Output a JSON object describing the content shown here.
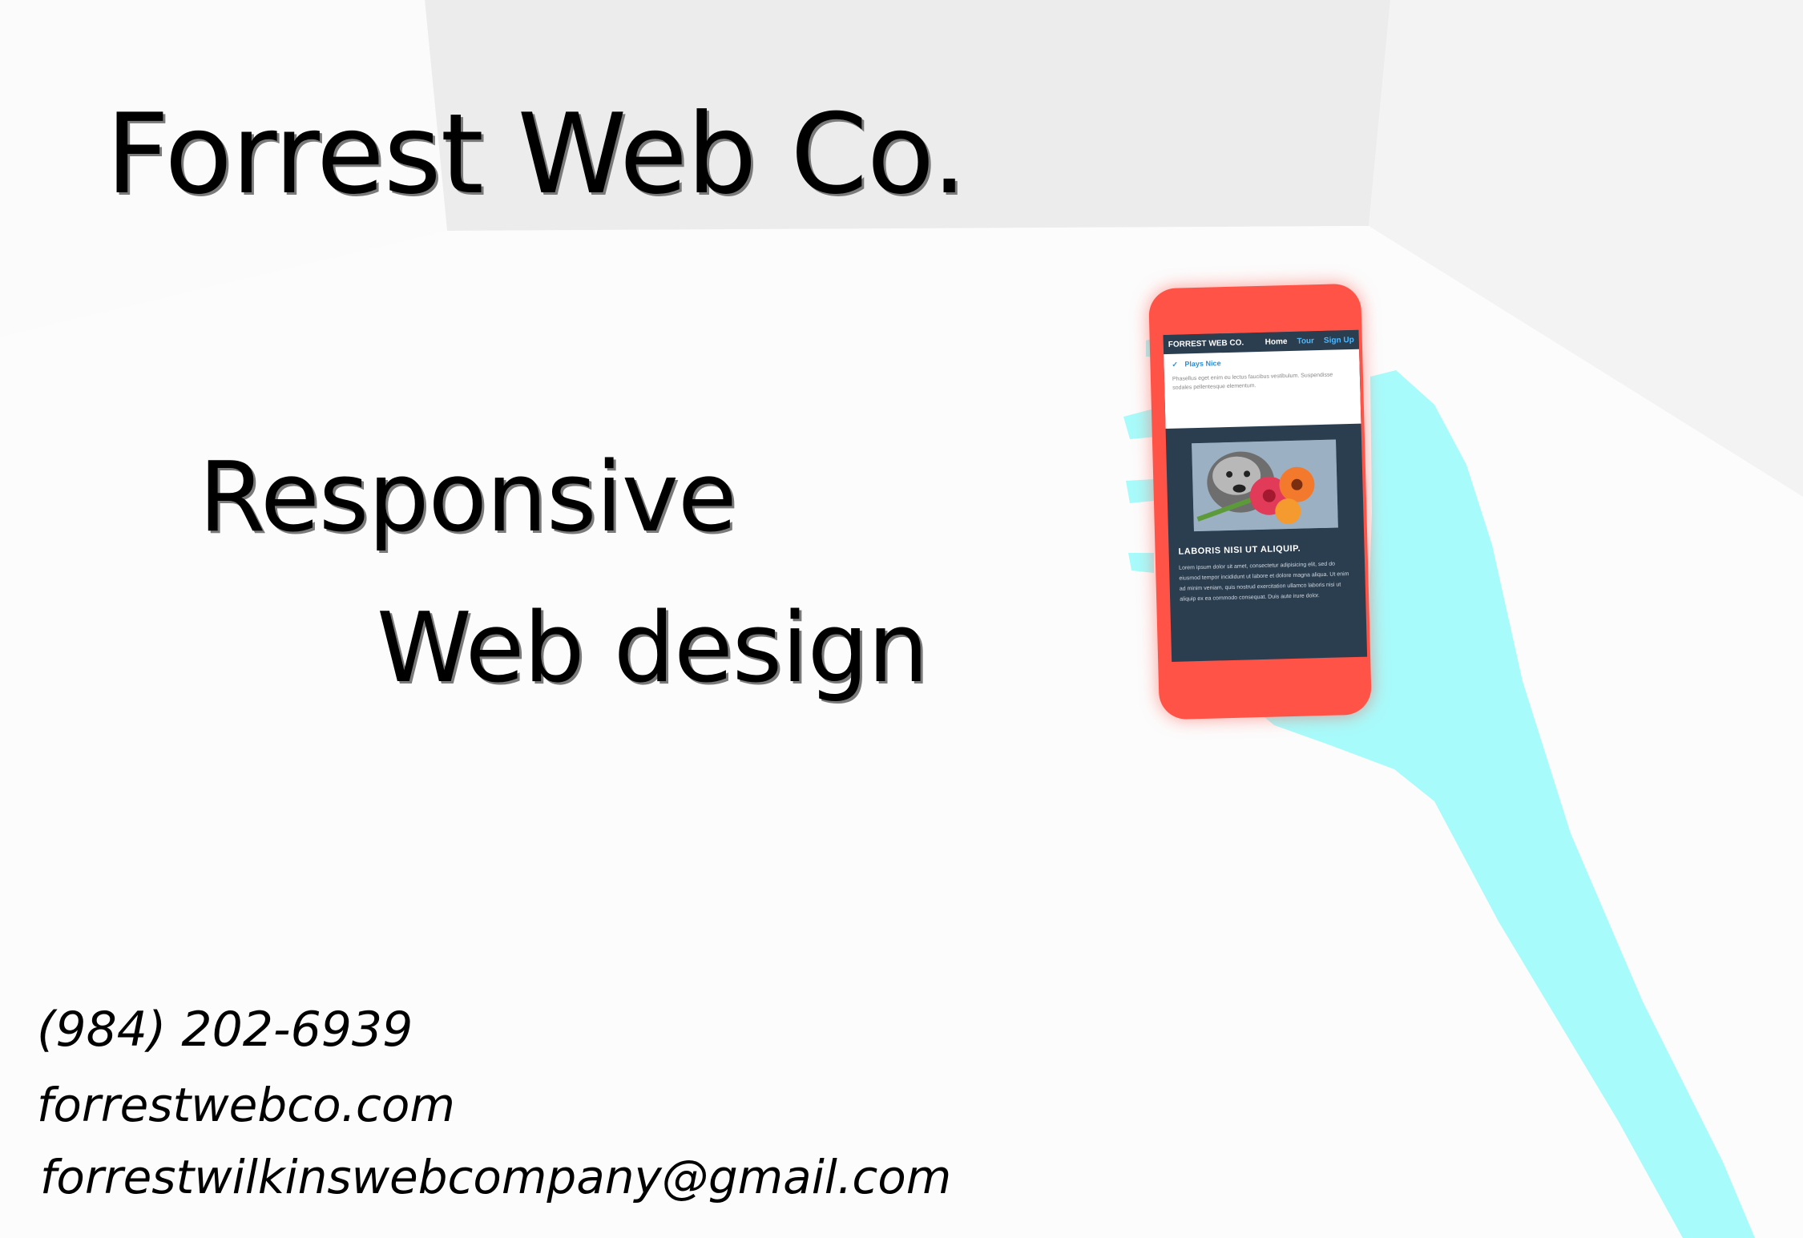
{
  "branding": {
    "title": "Forrest Web Co.",
    "tagline_line1": "Responsive",
    "tagline_line2": "Web design"
  },
  "contact": {
    "phone": "(984) 202-6939",
    "website": "forrestwebco.com",
    "email": "forrestwilkinswebcompany@gmail.com"
  },
  "phone_screen": {
    "nav": {
      "brand": "FORREST WEB CO.",
      "links": [
        "Home",
        "Tour",
        "Sign Up"
      ]
    },
    "feature": {
      "heading": "Plays Nice",
      "body": "Phasellus eget enim eu lectus faucibus vestibulum. Suspendisse sodales pellentesque elementum."
    },
    "article": {
      "title": "LABORIS NISI UT ALIQUIP.",
      "body": "Lorem ipsum dolor sit amet, consectetur adipisicing elit, sed do eiusmod tempor incididunt ut labore et dolore magna aliqua. Ut enim ad minim veniam, quis nostrud exercitation ullamco laboris nisi ut aliquip ex ea commodo consequat. Duis aute irure dolor."
    }
  },
  "colors": {
    "phone_body": "#ff5347",
    "hand": "#a8fbfb",
    "screen_dark": "#2b3e50",
    "link_blue": "#4db8ff"
  }
}
